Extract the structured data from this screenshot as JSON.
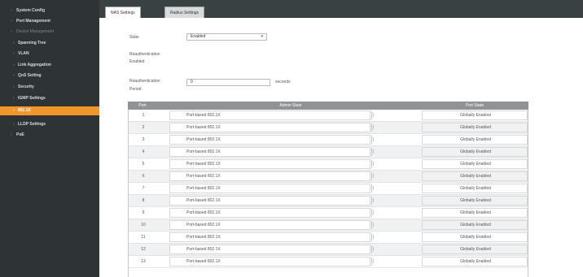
{
  "sidebar": {
    "items": [
      {
        "label": "System Config",
        "dim": false
      },
      {
        "label": "Port Management",
        "dim": false
      },
      {
        "label": "Device Management",
        "dim": true
      },
      {
        "label": "Spanning Tree",
        "dim": false,
        "sub": true
      },
      {
        "label": "VLAN",
        "dim": false,
        "sub": true
      },
      {
        "label": "Link Aggregation",
        "dim": false,
        "sub": true
      },
      {
        "label": "QoS Setting",
        "dim": false,
        "sub": true
      },
      {
        "label": "Security",
        "dim": false,
        "sub": true
      },
      {
        "label": "IGMP Settings",
        "dim": false,
        "sub": true
      },
      {
        "label": "802.1X",
        "dim": false,
        "sub": true,
        "active": true
      },
      {
        "label": "LLDP Settings",
        "dim": false,
        "sub": true
      },
      {
        "label": "PoE",
        "dim": false
      }
    ],
    "active_color": "#f0962b"
  },
  "tabs": [
    {
      "label": "NAS Settings",
      "active": true
    },
    {
      "label": "Radius Settings",
      "active": false
    }
  ],
  "form": {
    "state_label": "State",
    "state_value": "Enabled",
    "reauth_enabled_label_1": "Reauthentication",
    "reauth_enabled_label_2": "Enabled",
    "reauth_period_label_1": "Reauthentication",
    "reauth_period_label_2": "Period",
    "reauth_period_value": "0",
    "reauth_period_unit": "seconds"
  },
  "table": {
    "headers": [
      "Port",
      "Admin State",
      "Port State"
    ],
    "rows": [
      {
        "port": "1",
        "mode": "Port-based 802.1X",
        "sel": "|",
        "status": "Globally Enabled"
      },
      {
        "port": "2",
        "mode": "Port-based 802.1X",
        "sel": "|",
        "status": "Globally Enabled"
      },
      {
        "port": "3",
        "mode": "Port-based 802.1X",
        "sel": "|",
        "status": "Globally Enabled"
      },
      {
        "port": "4",
        "mode": "Port-based 802.1X",
        "sel": "|",
        "status": "Globally Enabled"
      },
      {
        "port": "5",
        "mode": "Port-based 802.1X",
        "sel": "|",
        "status": "Globally Enabled"
      },
      {
        "port": "6",
        "mode": "Port-based 802.1X",
        "sel": "|",
        "status": "Globally Enabled"
      },
      {
        "port": "7",
        "mode": "Port-based 802.1X",
        "sel": "|",
        "status": "Globally Enabled"
      },
      {
        "port": "8",
        "mode": "Port-based 802.1X",
        "sel": "|",
        "status": "Globally Enabled"
      },
      {
        "port": "9",
        "mode": "Port-based 802.1X",
        "sel": "|",
        "status": "Globally Enabled"
      },
      {
        "port": "10",
        "mode": "Port-based 802.1X",
        "sel": "|",
        "status": "Globally Enabled"
      },
      {
        "port": "11",
        "mode": "Port-based 802.1X",
        "sel": "|",
        "status": "Globally Enabled"
      },
      {
        "port": "12",
        "mode": "Port-based 802.1X",
        "sel": "|",
        "status": "Globally Enabled"
      },
      {
        "port": "13",
        "mode": "Port-based 802.1X",
        "sel": "|",
        "status": "Globally Enabled"
      }
    ]
  }
}
